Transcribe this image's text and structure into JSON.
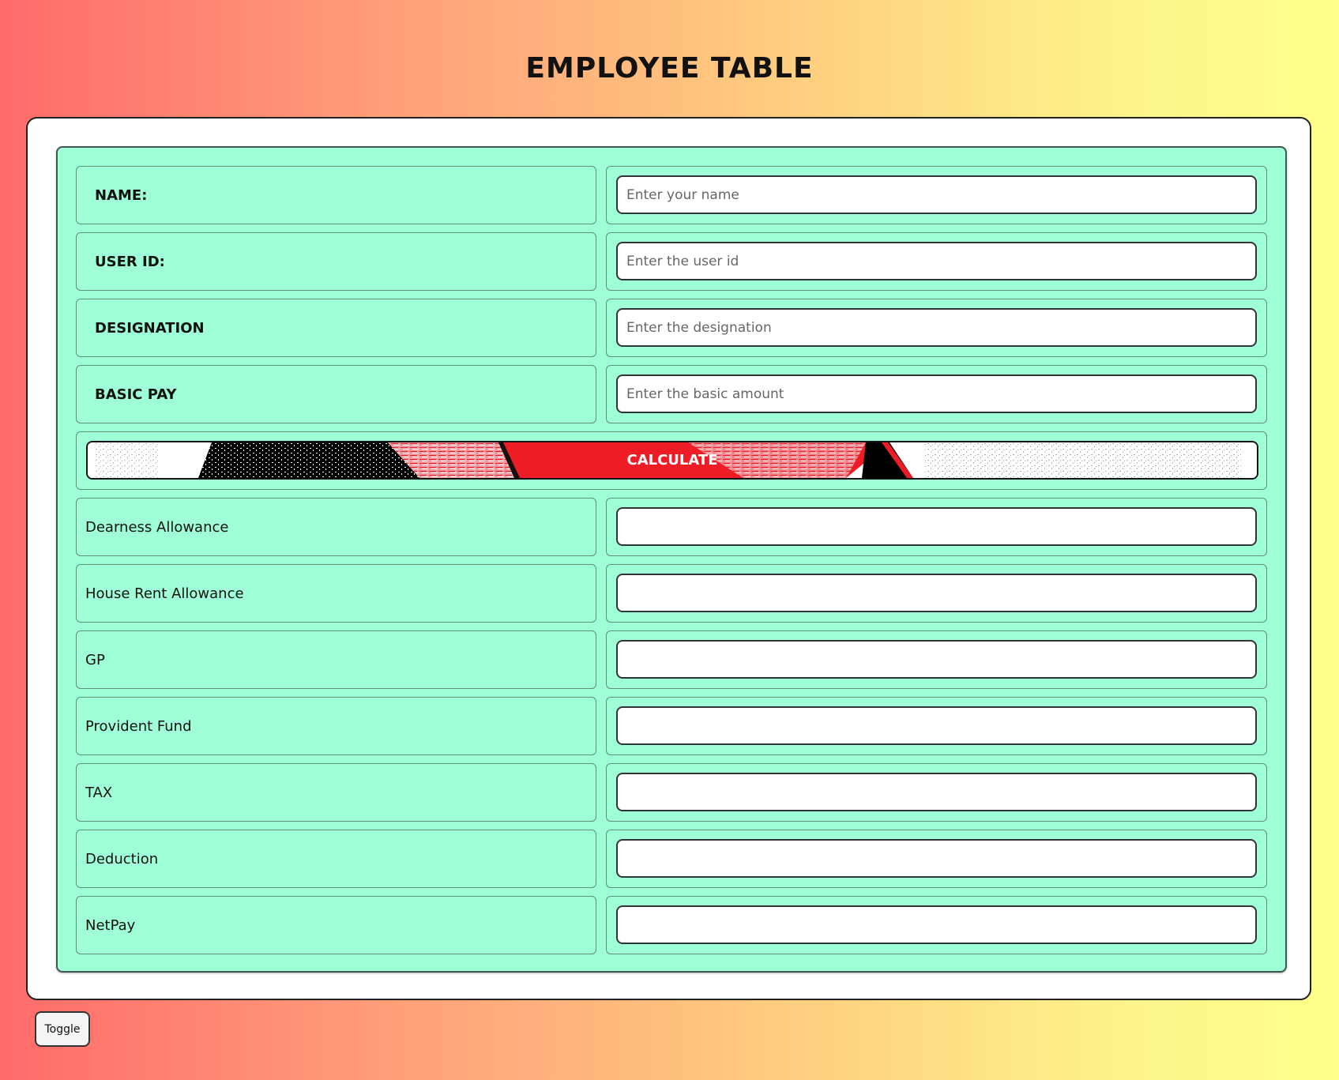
{
  "page": {
    "title": "EMPLOYEE TABLE"
  },
  "form": {
    "inputs": [
      {
        "label": "NAME:",
        "placeholder": "Enter your name",
        "value": ""
      },
      {
        "label": "USER ID:",
        "placeholder": "Enter the user id",
        "value": ""
      },
      {
        "label": "DESIGNATION",
        "placeholder": "Enter the designation",
        "value": ""
      },
      {
        "label": "BASIC PAY",
        "placeholder": "Enter the basic amount",
        "value": ""
      }
    ],
    "calculate_label": "CALCULATE",
    "outputs": [
      {
        "label": "Dearness Allowance",
        "value": ""
      },
      {
        "label": "House Rent Allowance",
        "value": ""
      },
      {
        "label": "GP",
        "value": ""
      },
      {
        "label": "Provident Fund",
        "value": ""
      },
      {
        "label": "TAX",
        "value": ""
      },
      {
        "label": "Deduction",
        "value": ""
      },
      {
        "label": "NetPay",
        "value": ""
      }
    ]
  },
  "toggle_label": "Toggle",
  "colors": {
    "panel_background": "#9fffd6",
    "calculate_red": "#ee1c25",
    "gradient_start": "#ff6b6b",
    "gradient_end": "#ffff8a"
  }
}
